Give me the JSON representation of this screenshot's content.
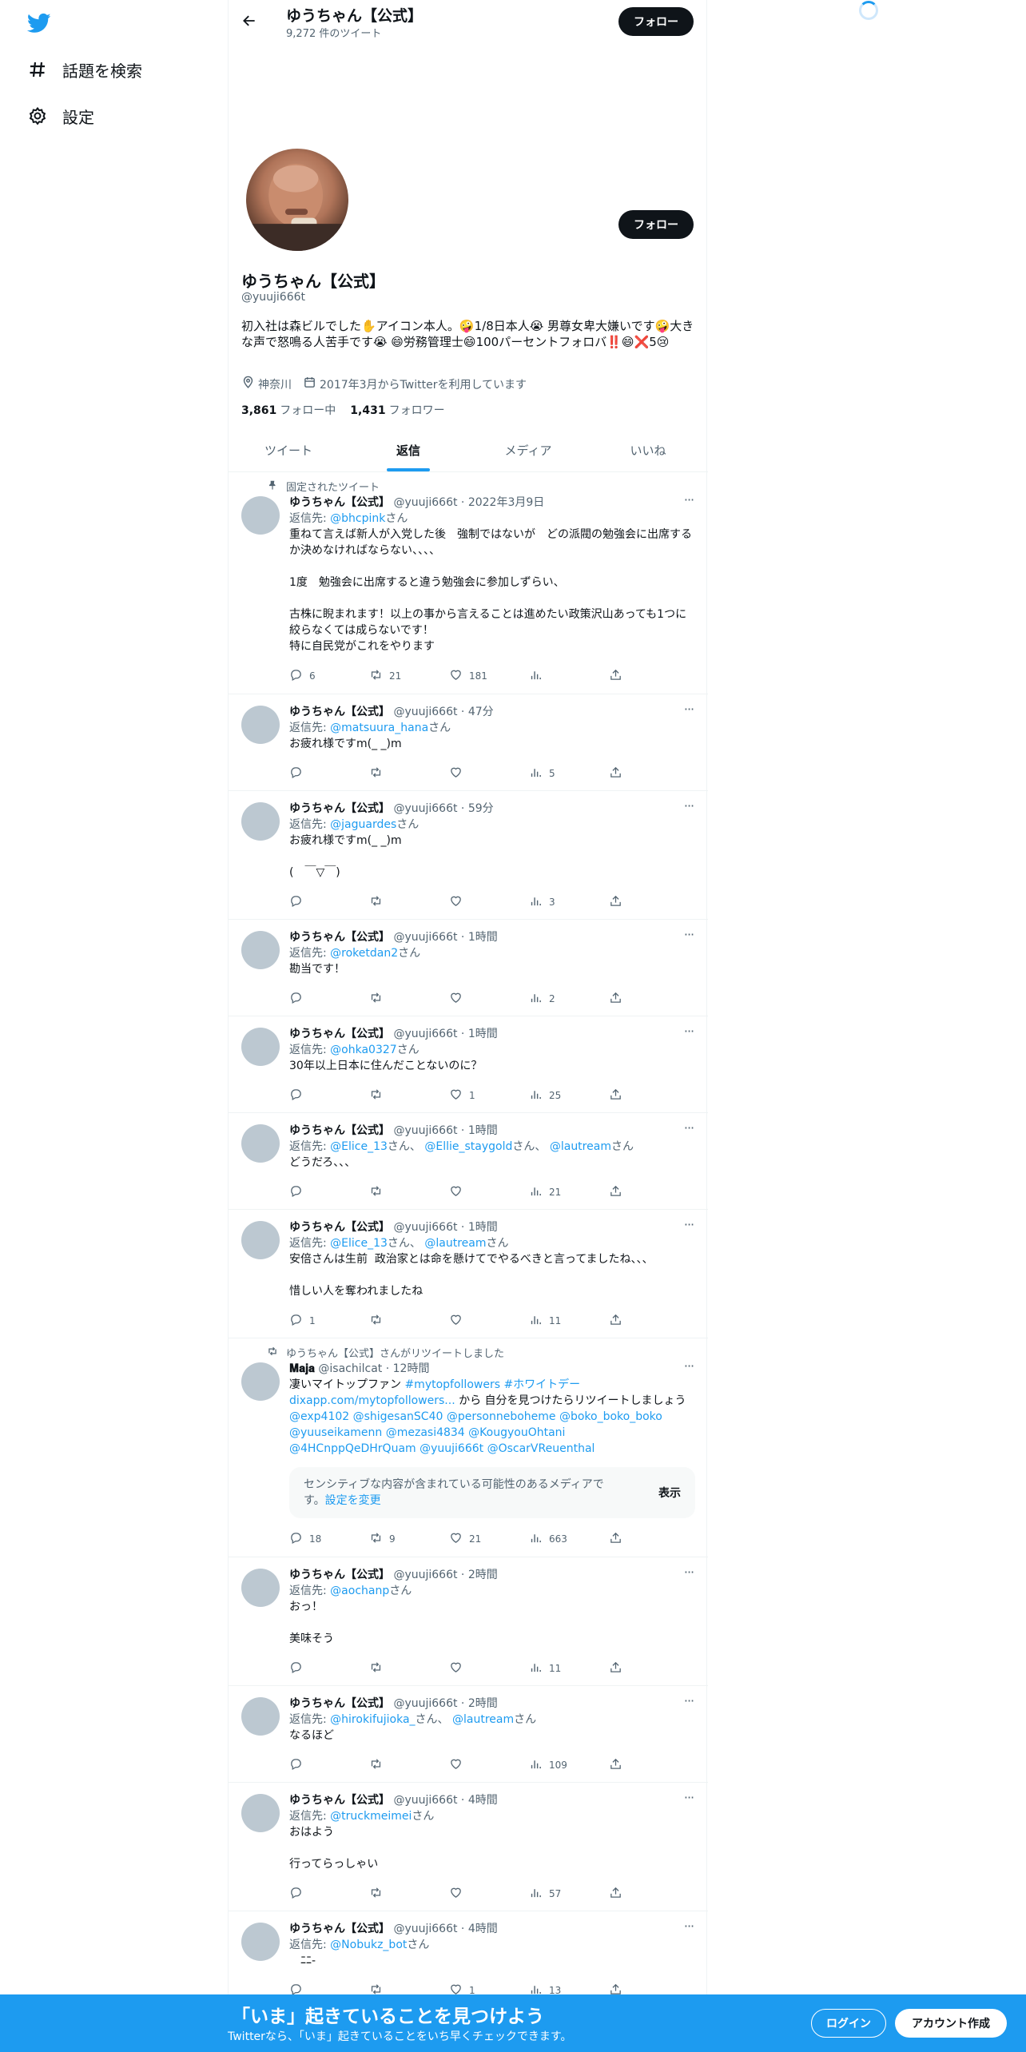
{
  "sidebar": {
    "items": [
      {
        "label": "話題を検索",
        "icon": "hashtag-icon"
      },
      {
        "label": "設定",
        "icon": "gear-icon"
      }
    ]
  },
  "header": {
    "title": "ゆうちゃん【公式】",
    "subtitle": "9,272 件のツイート",
    "follow_label": "フォロー"
  },
  "profile": {
    "follow_label": "フォロー",
    "name": "ゆうちゃん【公式】",
    "handle": "@yuuji666t",
    "bio": "初入社は森ビルでした✋アイコン本人。🤪1/8日本人😭 男尊女卑大嫌いです🤪大きな声で怒鳴る人苦手です😭 😄労務管理士😄100パーセントフォロバ‼️😄❌5😢",
    "location": "神奈川",
    "joined": "2017年3月からTwitterを利用しています",
    "following_count": "3,861",
    "following_label": "フォロー中",
    "followers_count": "1,431",
    "followers_label": "フォロワー"
  },
  "tabs": [
    "ツイート",
    "返信",
    "メディア",
    "いいね"
  ],
  "tweets": [
    {
      "context": "固定されたツイート",
      "name": "ゆうちゃん【公式】",
      "meta": "@yuuji666t · 2022年3月9日",
      "reply_prefix": "返信先: ",
      "reply_to": "@bhcpink",
      "reply_suffix": "さん",
      "text": "重ねて言えば新人が入党した後　強制ではないが　どの派閥の勉強会に出席するか決めなければならない、、、、\n\n1度　勉強会に出席すると違う勉強会に参加しずらい、\n\n古株に睨まれます！以上の事から言えることは進めたい政策沢山あっても1つに絞らなくては成らないです！\n特に自民党がこれをやります",
      "replies": "6",
      "retweets": "21",
      "likes": "181",
      "views": ""
    },
    {
      "name": "ゆうちゃん【公式】",
      "meta": "@yuuji666t · 47分",
      "reply_prefix": "返信先: ",
      "reply_to": "@matsuura_hana",
      "reply_suffix": "さん",
      "text": "お疲れ様ですm(_ _)m",
      "replies": "",
      "retweets": "",
      "likes": "",
      "views": "5"
    },
    {
      "name": "ゆうちゃん【公式】",
      "meta": "@yuuji666t · 59分",
      "reply_prefix": "返信先: ",
      "reply_to": "@jaguardes",
      "reply_suffix": "さん",
      "text": "お疲れ様ですm(_ _)m\n\n(　￣▽￣)",
      "replies": "",
      "retweets": "",
      "likes": "",
      "views": "3"
    },
    {
      "name": "ゆうちゃん【公式】",
      "meta": "@yuuji666t · 1時間",
      "reply_prefix": "返信先: ",
      "reply_to": "@roketdan2",
      "reply_suffix": "さん",
      "text": "勘当です！",
      "replies": "",
      "retweets": "",
      "likes": "",
      "views": "2"
    },
    {
      "name": "ゆうちゃん【公式】",
      "meta": "@yuuji666t · 1時間",
      "reply_prefix": "返信先: ",
      "reply_to": "@ohka0327",
      "reply_suffix": "さん",
      "text": "30年以上日本に住んだことないのに？",
      "replies": "",
      "retweets": "",
      "likes": "1",
      "views": "25"
    },
    {
      "name": "ゆうちゃん【公式】",
      "meta": "@yuuji666t · 1時間",
      "reply_prefix": "返信先: ",
      "reply_to": "@Elice_13",
      "reply_to2": "@Ellie_staygold",
      "reply_to3": "@lautream",
      "text": "どうだろ、、、",
      "replies": "",
      "retweets": "",
      "likes": "",
      "views": "21"
    },
    {
      "name": "ゆうちゃん【公式】",
      "meta": "@yuuji666t · 1時間",
      "reply_prefix": "返信先: ",
      "reply_to": "@Elice_13",
      "reply_to2": "@lautream",
      "text": "安倍さんは生前  政治家とは命を懸けてでやるべきと言ってましたね、、、\n\n惜しい人を奪われましたね",
      "replies": "1",
      "retweets": "",
      "likes": "",
      "views": "11"
    },
    {
      "context": "ゆうちゃん【公式】さんがリツイートしました",
      "name": "𝐌𝐚𝐣𝐚",
      "meta": "@isachilcat · 12時間",
      "text_prefix": "凄いマイトップファン ",
      "hashtags": "#mytopfollowers #ホワイトデー",
      "link": "dixapp.com/mytopfollowers...",
      "link_suffix": " から 自分を見つけたらリツイートしましょう ",
      "mentions": "@exp4102 @shigesanSC40 @personneboheme @boko_boko_boko @yuuseikamenn @mezasi4834 @KougyouOhtani @4HCnppQeDHrQuam @yuuji666t @OscarVReuenthal",
      "sensitive_text": "センシティブな内容が含まれている可能性のあるメディアです。",
      "sensitive_link": "設定を変更",
      "sensitive_show": "表示",
      "replies": "18",
      "retweets": "9",
      "likes": "21",
      "views": "663"
    },
    {
      "name": "ゆうちゃん【公式】",
      "meta": "@yuuji666t · 2時間",
      "reply_prefix": "返信先: ",
      "reply_to": "@aochanp",
      "reply_suffix": "さん",
      "text": "おっ！\n\n美味そう",
      "replies": "",
      "retweets": "",
      "likes": "",
      "views": "11"
    },
    {
      "name": "ゆうちゃん【公式】",
      "meta": "@yuuji666t · 2時間",
      "reply_prefix": "返信先: ",
      "reply_to": "@hirokifujioka_",
      "reply_to2": "@lautream",
      "text": "なるほど",
      "replies": "",
      "retweets": "",
      "likes": "",
      "views": "109"
    },
    {
      "name": "ゆうちゃん【公式】",
      "meta": "@yuuji666t · 4時間",
      "reply_prefix": "返信先: ",
      "reply_to": "@truckmeimei",
      "reply_suffix": "さん",
      "text": "おはよう\n\n行ってらっしゃい",
      "replies": "",
      "retweets": "",
      "likes": "",
      "views": "57"
    },
    {
      "name": "ゆうちゃん【公式】",
      "meta": "@yuuji666t · 4時間",
      "reply_prefix": "返信先: ",
      "reply_to": "@Nobukz_bot",
      "reply_suffix": "さん",
      "text": "　ﾆﾆ-",
      "replies": "",
      "retweets": "",
      "likes": "1",
      "views": "13"
    }
  ],
  "san": "さん",
  "comma": "、",
  "bottom_bar": {
    "title": "「いま」起きていることを見つけよう",
    "subtitle": "Twitterなら、「いま」起きていることをいち早くチェックできます。",
    "login": "ログイン",
    "signup": "アカウント作成"
  },
  "colors": {
    "accent": "#1d9bf0",
    "text": "#0f1419",
    "muted": "#536471"
  }
}
